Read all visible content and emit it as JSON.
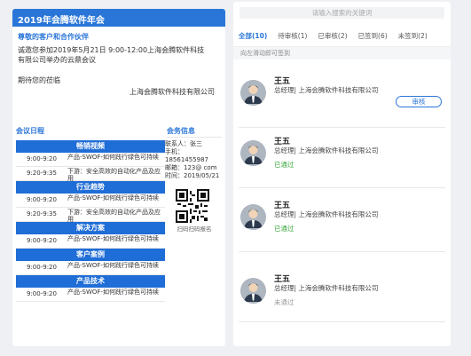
{
  "left": {
    "header_title": "2019年会腾软件年会",
    "greeting": "尊敬的客户和合作伙伴",
    "invite_text_line1": "诚邀您参加2019年5月21日 9:00-12:00上海会腾软件科技",
    "invite_text_line2": "有限公司举办的云鼎会议",
    "closing": "期待您的莅临",
    "signature": "上海会腾软件科技有限公司",
    "schedule_title": "会议日程",
    "contact_title": "会务信息",
    "categories": [
      {
        "name": "畅销视频",
        "rows": [
          {
            "time": "9:00-9:20",
            "desc": "产品-SWOF-如何践行绿色可持续"
          },
          {
            "time": "9:20-9:35",
            "desc": "下游：安全高效的自动化产品及应用"
          }
        ]
      },
      {
        "name": "行业趋势",
        "rows": [
          {
            "time": "9:00-9:20",
            "desc": "产品-SWOF-如何践行绿色可持续"
          },
          {
            "time": "9:20-9:35",
            "desc": "下游：安全高效的自动化产品及应用"
          }
        ]
      },
      {
        "name": "解决方案",
        "rows": [
          {
            "time": "9:00-9:20",
            "desc": "产品-SWOF-如何践行绿色可持续"
          }
        ]
      },
      {
        "name": "客户案例",
        "rows": [
          {
            "time": "9:00-9:20",
            "desc": "产品-SWOF-如何践行绿色可持续"
          }
        ]
      },
      {
        "name": "产品技术",
        "rows": [
          {
            "time": "9:00-9:20",
            "desc": "产品-SWOF-如何践行绿色可持续"
          }
        ]
      }
    ],
    "contact": {
      "person": "联系人：张三",
      "phone": "手机：18561455987",
      "email": "邮箱：123@ com",
      "time": "时间：2019/05/21",
      "qr_caption": "扫码扫码报名"
    }
  },
  "right": {
    "search_placeholder": "请输入搜索的关键词",
    "tabs": [
      {
        "label": "全部(10)"
      },
      {
        "label": "待审核(1)"
      },
      {
        "label": "已审核(2)"
      },
      {
        "label": "已签到(6)"
      },
      {
        "label": "未签到(2)"
      }
    ],
    "hint": "向左滑动即可签到",
    "people": [
      {
        "name": "王五",
        "title": "总经理| 上海会腾软件科技有限公司",
        "status": "",
        "button": "审核"
      },
      {
        "name": "王五",
        "title": "总经理| 上海会腾软件科技有限公司",
        "status": "已通过"
      },
      {
        "name": "王五",
        "title": "总经理| 上海会腾软件科技有限公司",
        "status": "已通过"
      },
      {
        "name": "王五",
        "title": "总经理| 上海会腾软件科技有限公司",
        "status": "未通过"
      }
    ],
    "colors": {
      "accent": "#2a76d8",
      "approved": "#3aa63a",
      "rejected": "#999999"
    }
  }
}
